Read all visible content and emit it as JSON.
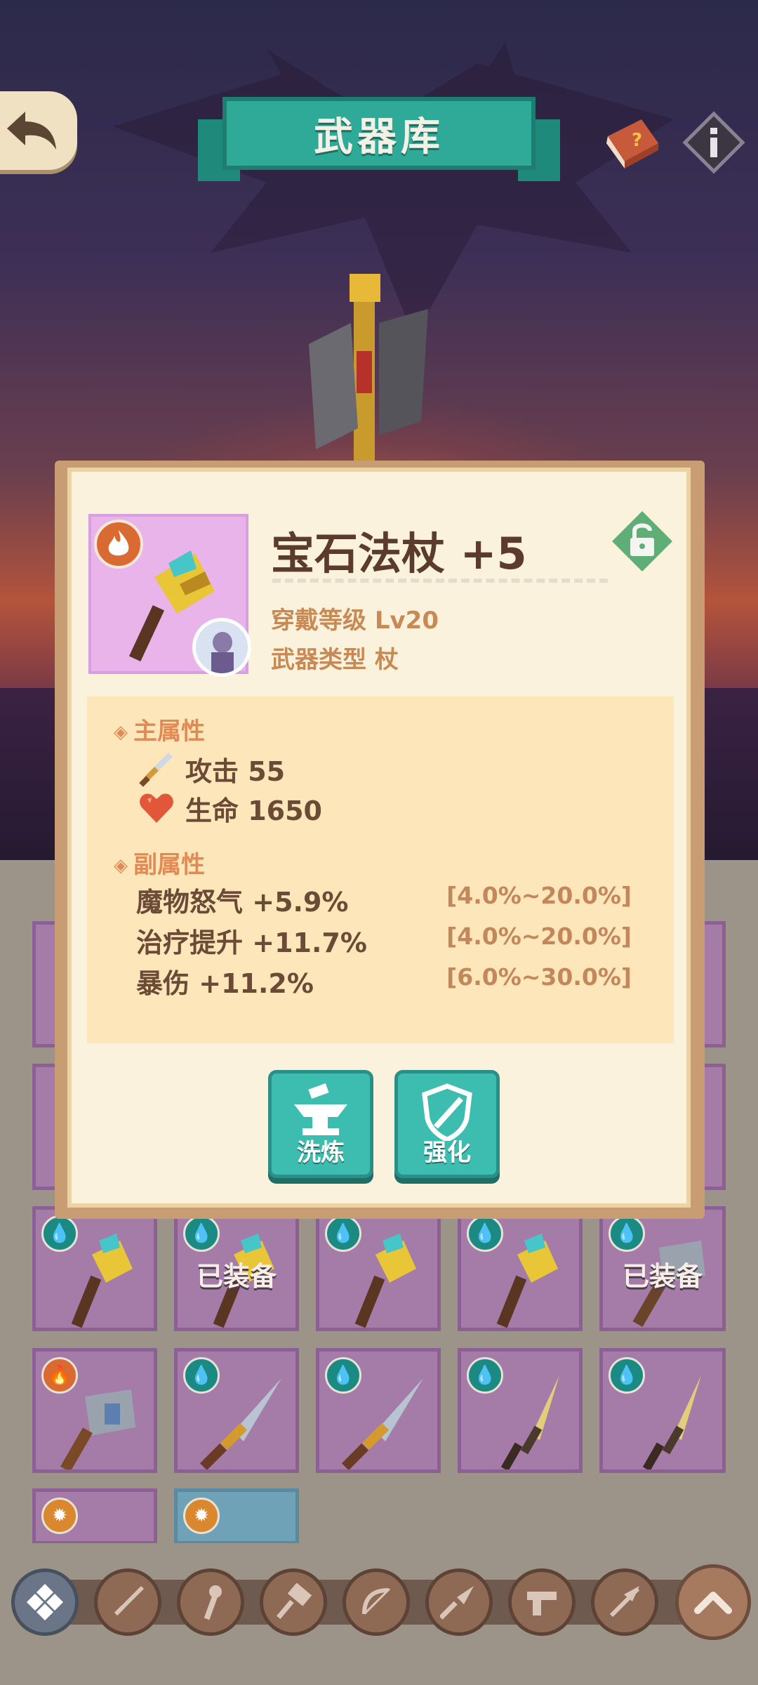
{
  "header": {
    "title": "武器库",
    "back_icon": "back-arrow-icon",
    "book_icon": "help-book-icon",
    "info_icon": "info-icon"
  },
  "colors": {
    "title_ribbon": "#2faa98",
    "card_bg": "#fbf2dd",
    "stats_bg": "#fde6b9",
    "action_button": "#3cbdb0",
    "slot_purple": "#a57ba8",
    "fire": "#d86a32",
    "water": "#1b8a83"
  },
  "item": {
    "name": "宝石法杖 +5",
    "element_icon": "fire-icon",
    "wearer_icon": "character-avatar-icon",
    "lock_icon": "unlocked-lock-icon",
    "wear_level": "穿戴等级 Lv20",
    "weapon_type": "武器类型 杖"
  },
  "main_attributes": {
    "heading": "主属性",
    "stats": [
      {
        "icon": "sword-icon",
        "text": "攻击 55"
      },
      {
        "icon": "heart-icon",
        "text": "生命 1650"
      }
    ]
  },
  "sub_attributes": {
    "heading": "副属性",
    "stats": [
      {
        "text": "魔物怒气 +5.9%",
        "range": "[4.0%~20.0%]"
      },
      {
        "text": "治疗提升 +11.7%",
        "range": "[4.0%~20.0%]"
      },
      {
        "text": "暴伤 +11.2%",
        "range": "[6.0%~30.0%]"
      }
    ]
  },
  "actions": {
    "reforge": {
      "label": "洗炼",
      "icon": "anvil-icon"
    },
    "enhance": {
      "label": "强化",
      "icon": "shield-sword-icon"
    }
  },
  "inventory": {
    "equipped_label": "已装备",
    "rows": [
      [
        {
          "element": "water",
          "item": "gem-staff",
          "equipped": false
        },
        {
          "element": "water",
          "item": "gem-staff",
          "equipped": true
        },
        {
          "element": "water",
          "item": "gem-staff",
          "equipped": false
        },
        {
          "element": "water",
          "item": "gem-staff",
          "equipped": false
        },
        {
          "element": "water",
          "item": "hammer",
          "equipped": true
        }
      ],
      [
        {
          "element": "fire",
          "item": "hammer",
          "equipped": false
        },
        {
          "element": "water",
          "item": "dagger",
          "equipped": false
        },
        {
          "element": "water",
          "item": "dagger",
          "equipped": false
        },
        {
          "element": "water",
          "item": "short-sword",
          "equipped": false
        },
        {
          "element": "water",
          "item": "short-sword",
          "equipped": false
        }
      ]
    ]
  },
  "bottom_nav": [
    {
      "icon": "all-categories-icon"
    },
    {
      "icon": "sword-category-icon"
    },
    {
      "icon": "staff-category-icon"
    },
    {
      "icon": "hammer-category-icon"
    },
    {
      "icon": "bow-category-icon"
    },
    {
      "icon": "spear-category-icon"
    },
    {
      "icon": "gun-category-icon"
    },
    {
      "icon": "lance-category-icon"
    },
    {
      "icon": "collapse-up-icon"
    }
  ]
}
